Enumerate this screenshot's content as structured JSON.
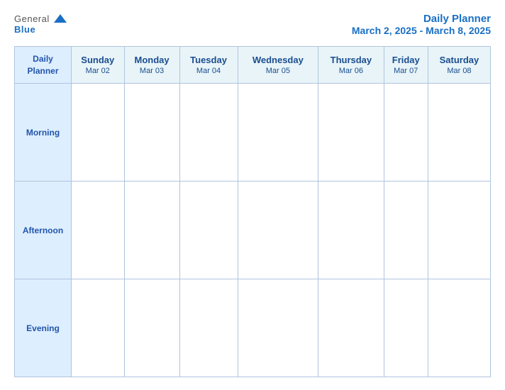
{
  "logo": {
    "general": "General",
    "blue": "Blue",
    "icon": "▶"
  },
  "title": {
    "line1": "Daily Planner",
    "line2": "March 2, 2025 - March 8, 2025"
  },
  "header_col": {
    "line1": "Daily",
    "line2": "Planner"
  },
  "days": [
    {
      "name": "Sunday",
      "date": "Mar 02"
    },
    {
      "name": "Monday",
      "date": "Mar 03"
    },
    {
      "name": "Tuesday",
      "date": "Mar 04"
    },
    {
      "name": "Wednesday",
      "date": "Mar 05"
    },
    {
      "name": "Thursday",
      "date": "Mar 06"
    },
    {
      "name": "Friday",
      "date": "Mar 07"
    },
    {
      "name": "Saturday",
      "date": "Mar 08"
    }
  ],
  "rows": [
    {
      "label": "Morning"
    },
    {
      "label": "Afternoon"
    },
    {
      "label": "Evening"
    }
  ]
}
